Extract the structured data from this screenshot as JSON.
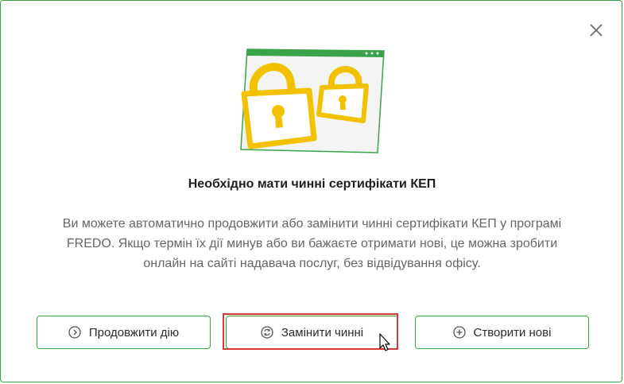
{
  "dialog": {
    "title": "Необхідно мати чинні сертифікати КЕП",
    "description": "Ви можете автоматично продовжити або замінити чинні сертифікати КЕП у програмі FREDO. Якщо термін їх дії минув або ви бажаєте отримати нові, це можна зробити онлайн на сайті надавача послуг, без відвідування офісу.",
    "close_icon": "close-icon"
  },
  "buttons": {
    "continue_label": "Продовжити дію",
    "replace_label": "Замінити чинні",
    "create_label": "Створити нові"
  },
  "icons": {
    "continue": "arrow-right-circle-icon",
    "replace": "refresh-circle-icon",
    "create": "plus-circle-icon"
  },
  "colors": {
    "accent": "#3aa34a",
    "lock": "#f2c200",
    "highlight": "#d93a3a"
  }
}
